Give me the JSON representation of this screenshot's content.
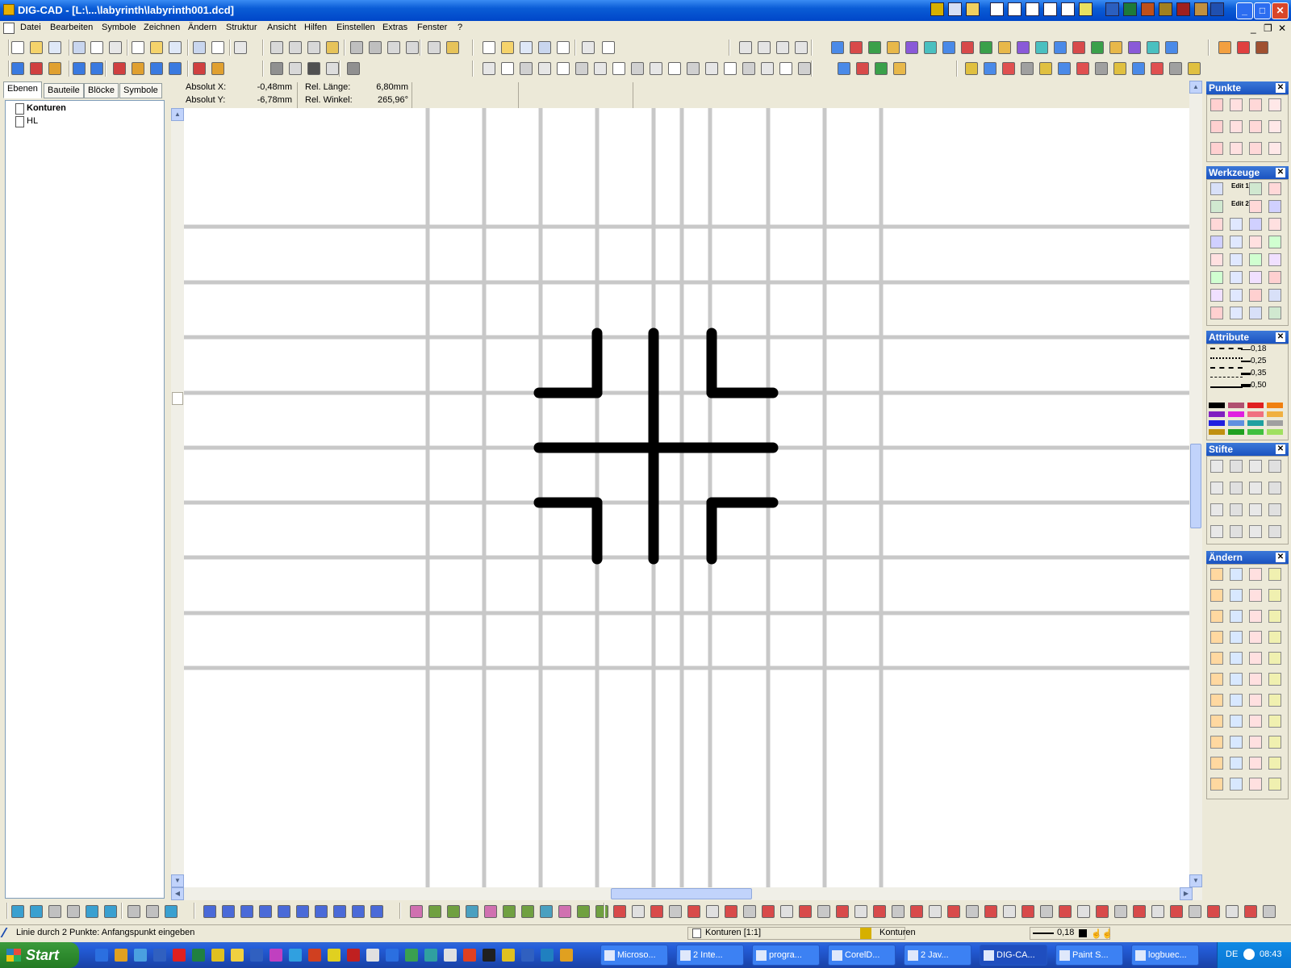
{
  "window": {
    "title": "DIG-CAD - [L:\\...\\labyrinth\\labyrinth001.dcd]",
    "min": "_",
    "max": "□",
    "close": "✕"
  },
  "menu": {
    "items": [
      "Datei",
      "Bearbeiten",
      "Symbole",
      "Zeichnen",
      "Ändern",
      "Struktur",
      "Ansicht",
      "Hilfen",
      "Einstellen",
      "Extras",
      "Fenster",
      "?"
    ],
    "mdi_min": "_",
    "mdi_restore": "❐",
    "mdi_close": "✕"
  },
  "left_panel": {
    "tabs": [
      "Ebenen",
      "Bauteile",
      "Blöcke",
      "Symbole"
    ],
    "tree": [
      "Konturen",
      "HL"
    ]
  },
  "readout": {
    "abs_x_label": "Absolut X:",
    "abs_x_value": "-0,48mm",
    "abs_y_label": "Absolut Y:",
    "abs_y_value": "-6,78mm",
    "rel_len_label": "Rel. Länge:",
    "rel_len_value": "6,80mm",
    "rel_ang_label": "Rel. Winkel:",
    "rel_ang_value": "265,96°"
  },
  "palettes": {
    "punkte": "Punkte",
    "werkzeuge": "Werkzeuge",
    "attribute": "Attribute",
    "stifte": "Stifte",
    "aendern": "Ändern",
    "close": "✕",
    "edit1": "Edit 1",
    "edit2": "Edit 2",
    "line_widths": [
      "0,18",
      "0,25",
      "0,35",
      "0,50"
    ],
    "swatches": [
      "#000000",
      "#b05070",
      "#e02020",
      "#f08010",
      "#8020c0",
      "#e020e0",
      "#f07080",
      "#f0b040",
      "#2020e0",
      "#6090e0",
      "#20a0a0",
      "#a0a0a0",
      "#c09010",
      "#20a020",
      "#40c040",
      "#a0e060"
    ]
  },
  "status": {
    "hint": "Linie durch 2 Punkte: Anfangspunkt eingeben",
    "layer": "Konturen [1:1]",
    "layer2": "Konturen",
    "pen": "0,18"
  },
  "taskbar": {
    "start": "Start",
    "tasks": [
      "Microso...",
      "2 Inte...",
      "progra...",
      "CorelD...",
      "2 Jav...",
      "DIG-CA...",
      "Paint S...",
      "logbuec..."
    ],
    "lang": "DE",
    "clock": "08:43"
  },
  "colors": {
    "grid": "#c8c8c8",
    "drawing": "#000000",
    "title_bar": "#0a5cd6",
    "taskbar": "#245edb"
  },
  "drawing": {
    "grid_v": [
      530,
      600,
      670,
      740,
      810,
      845,
      880,
      952,
      1022,
      1092
    ],
    "grid_h": [
      281,
      350,
      418,
      487,
      555,
      623,
      691,
      760,
      828
    ],
    "segments": [
      [
        740,
        413,
        740,
        487
      ],
      [
        740,
        487,
        668,
        487
      ],
      [
        882,
        413,
        882,
        487
      ],
      [
        882,
        487,
        958,
        487
      ],
      [
        810,
        413,
        810,
        693
      ],
      [
        668,
        555,
        958,
        555
      ],
      [
        668,
        623,
        740,
        623
      ],
      [
        740,
        623,
        740,
        693
      ],
      [
        882,
        623,
        958,
        623
      ],
      [
        882,
        623,
        882,
        693
      ]
    ]
  }
}
